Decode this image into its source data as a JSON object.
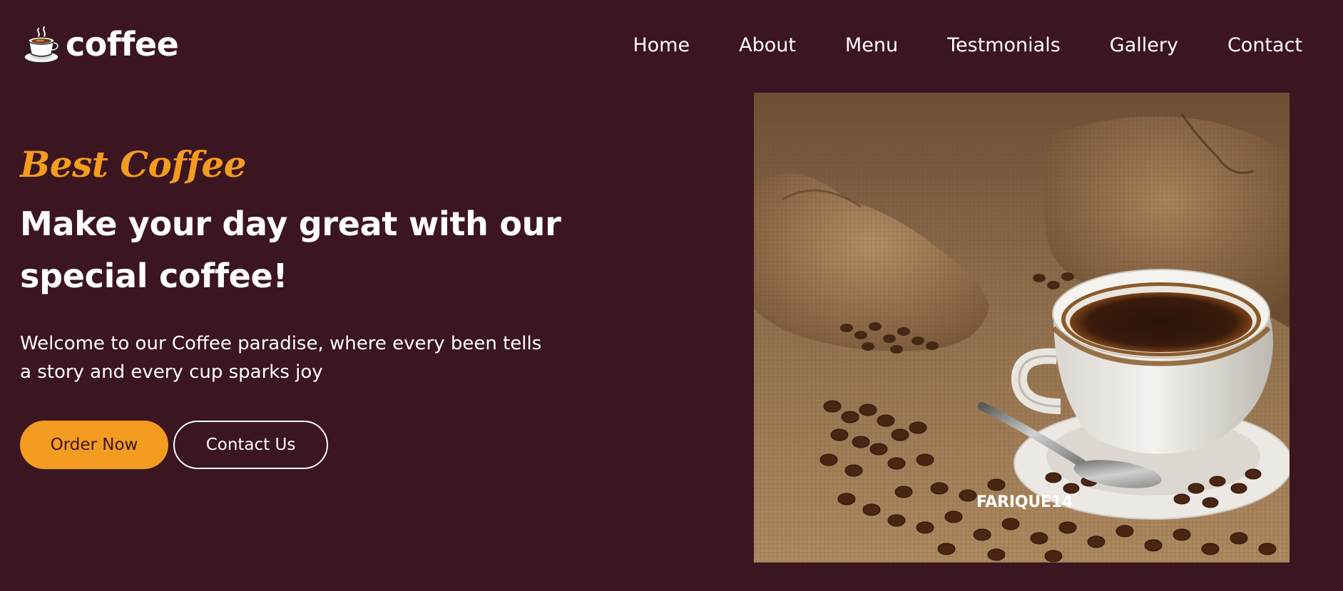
{
  "brand": {
    "name": "coffee",
    "icon": "coffee-cup-icon"
  },
  "nav": {
    "items": [
      {
        "label": "Home"
      },
      {
        "label": "About"
      },
      {
        "label": "Menu"
      },
      {
        "label": "Testmonials"
      },
      {
        "label": "Gallery"
      },
      {
        "label": "Contact"
      }
    ]
  },
  "hero": {
    "tagline": "Best Coffee",
    "headline": "Make your day great with our special coffee!",
    "description": "Welcome to our Coffee paradise, where every been tells a story and every cup sparks joy",
    "primary_button": "Order Now",
    "secondary_button": "Contact Us",
    "image_watermark": "FARIQUE14"
  },
  "colors": {
    "background": "#3b1520",
    "accent": "#f39c1f",
    "text": "#ffffff"
  }
}
